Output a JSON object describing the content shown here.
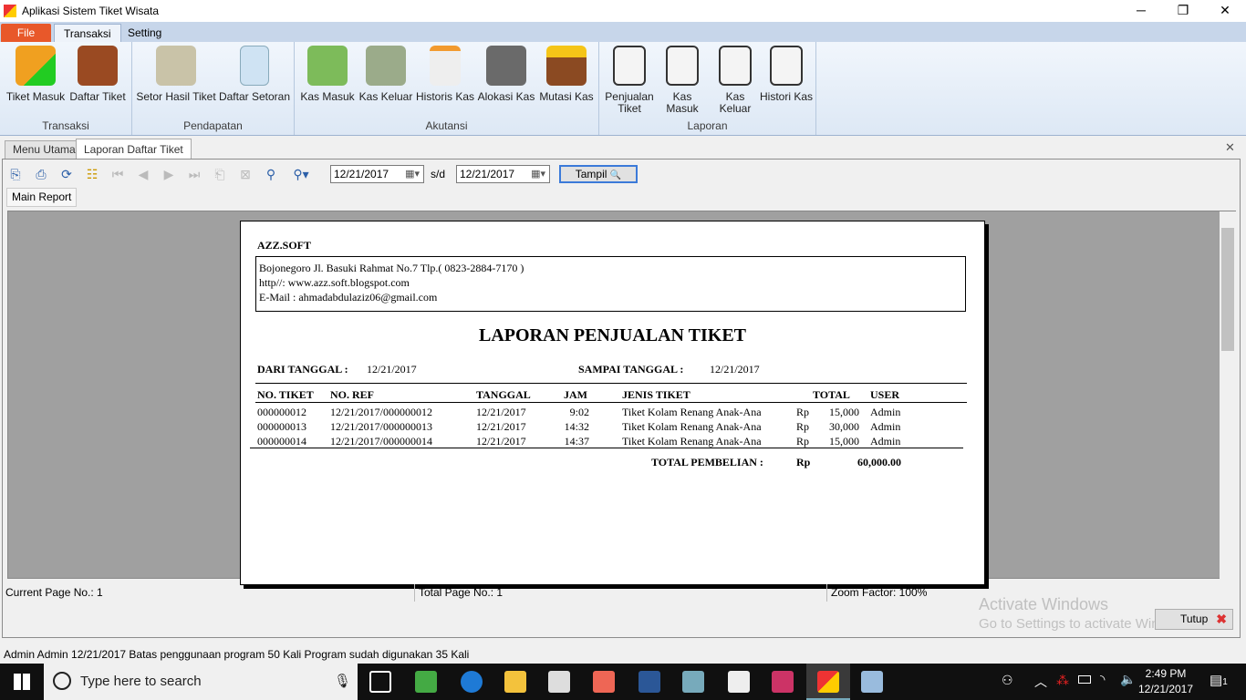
{
  "window": {
    "title": "Aplikasi Sistem Tiket Wisata",
    "minimize": "─",
    "maximize": "❐",
    "close": "✕"
  },
  "ribbon": {
    "tabs": [
      "File",
      "Transaksi",
      "Setting"
    ],
    "groups": [
      {
        "label": "Transaksi",
        "buttons": [
          "Tiket Masuk",
          "Daftar Tiket"
        ]
      },
      {
        "label": "Pendapatan",
        "buttons": [
          "Setor Hasil Tiket",
          "Daftar Setoran"
        ]
      },
      {
        "label": "Akutansi",
        "buttons": [
          "Kas Masuk",
          "Kas Keluar",
          "Historis Kas",
          "Alokasi Kas",
          "Mutasi Kas"
        ]
      },
      {
        "label": "Laporan",
        "buttons": [
          "Penjualan Tiket",
          "Kas Masuk",
          "Kas Keluar",
          "Histori Kas"
        ]
      }
    ]
  },
  "doc_tabs": [
    "Menu Utama",
    "Laporan  Daftar Tiket"
  ],
  "doc_close": "✕",
  "toolbar": {
    "date_from": "12/21/2017",
    "sep": "s/d",
    "date_to": "12/21/2017",
    "tampil": "Tampil",
    "search_glyph": "🔍"
  },
  "report_tab": "Main Report",
  "report": {
    "company": "AZZ.SOFT",
    "address": "Bojonegoro Jl. Basuki Rahmat No.7  Tlp.( 0823-2884-7170 )",
    "web": "http//: www.azz.soft.blogspot.com",
    "email": "E-Mail : ahmadabdulaziz06@gmail.com",
    "title": "LAPORAN PENJUALAN TIKET",
    "from_label": "DARI TANGGAL :",
    "from_value": "12/21/2017",
    "to_label": "SAMPAI TANGGAL :",
    "to_value": "12/21/2017",
    "columns": [
      "NO. TIKET",
      "NO. REF",
      "TANGGAL",
      "JAM",
      "JENIS TIKET",
      "TOTAL",
      "USER"
    ],
    "rows": [
      {
        "no": "000000012",
        "ref": "12/21/2017/000000012",
        "tanggal": "12/21/2017",
        "jam": "9:02",
        "jenis": "Tiket Kolam Renang Anak-Ana",
        "cur": "Rp",
        "total": "15,000",
        "user": "Admin"
      },
      {
        "no": "000000013",
        "ref": "12/21/2017/000000013",
        "tanggal": "12/21/2017",
        "jam": "14:32",
        "jenis": "Tiket Kolam Renang Anak-Ana",
        "cur": "Rp",
        "total": "30,000",
        "user": "Admin"
      },
      {
        "no": "000000014",
        "ref": "12/21/2017/000000014",
        "tanggal": "12/21/2017",
        "jam": "14:37",
        "jenis": "Tiket Kolam Renang Anak-Ana",
        "cur": "Rp",
        "total": "15,000",
        "user": "Admin"
      }
    ],
    "total_label": "TOTAL PEMBELIAN :",
    "total_cur": "Rp",
    "total_value": "60,000.00"
  },
  "viewer_status": {
    "current_page": "Current Page No.: 1",
    "total_page": "Total Page No.: 1",
    "zoom": "Zoom Factor: 100%"
  },
  "tutup": "Tutup",
  "watermark": {
    "line1": "Activate Windows",
    "line2": "Go to Settings to activate Windows."
  },
  "app_status": "Admin  Admin  12/21/2017  Batas penggunaan program  50  Kali  Program sudah digunakan  35  Kali",
  "taskbar": {
    "search_placeholder": "Type here to search",
    "time": "2:49 PM",
    "date": "12/21/2017",
    "notifications": "1"
  }
}
